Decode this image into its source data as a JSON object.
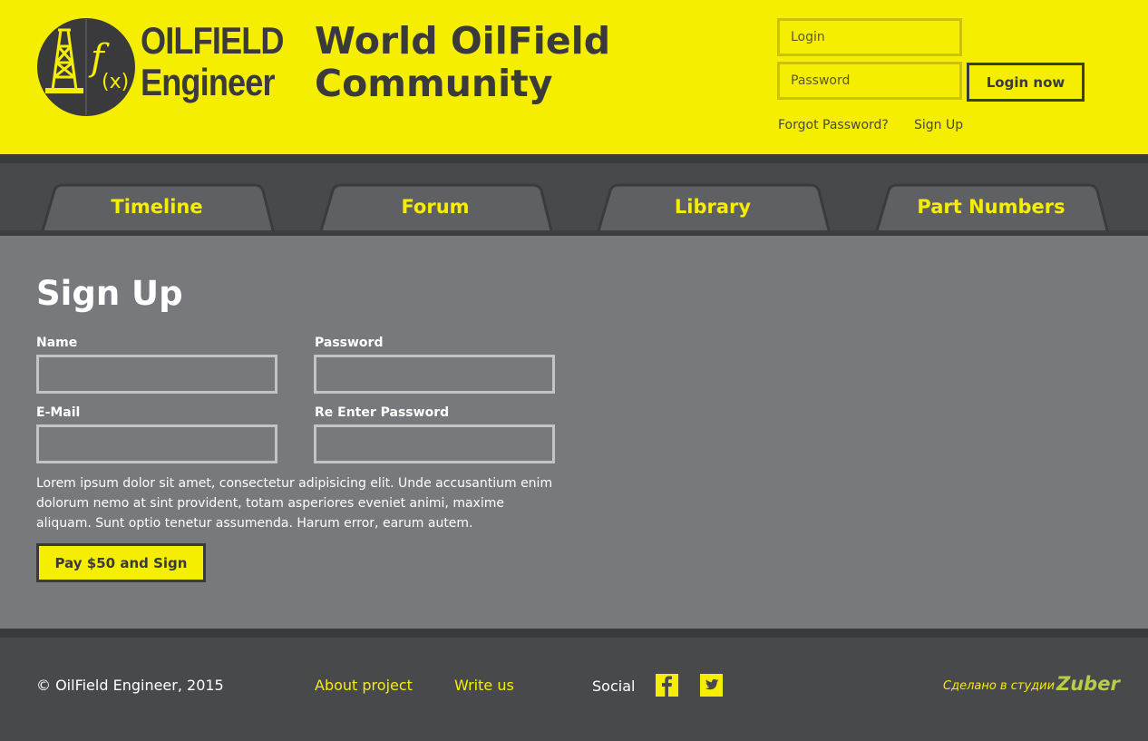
{
  "header": {
    "logo_line1": "OILFIELD",
    "logo_line2": "Engineer",
    "title_line1": "World OilField",
    "title_line2": "Community",
    "login_placeholder": "Login",
    "password_placeholder": "Password",
    "login_button": "Login now",
    "forgot_password": "Forgot Password?",
    "sign_up": "Sign Up"
  },
  "nav": {
    "tabs": [
      {
        "label": "Timeline"
      },
      {
        "label": "Forum"
      },
      {
        "label": "Library"
      },
      {
        "label": "Part Numbers"
      }
    ]
  },
  "main": {
    "title": "Sign Up",
    "fields": {
      "name_label": "Name",
      "password_label": "Password",
      "email_label": "E-Mail",
      "reenter_label": "Re Enter Password"
    },
    "description": "Lorem ipsum dolor sit amet, consectetur adipisicing elit. Unde accusantium enim dolorum nemo at sint provident, totam asperiores eveniet animi, maxime aliquam. Sunt optio tenetur assumenda. Harum error, earum autem.",
    "submit_button": "Pay $50 and Sign"
  },
  "footer": {
    "copyright": "© OilField Engineer, 2015",
    "about": "About project",
    "write_us": "Write us",
    "social_label": "Social",
    "social_icons": [
      "facebook-icon",
      "twitter-icon"
    ],
    "studio_text": "Сделано в студии",
    "studio_brand": "Zuber"
  },
  "colors": {
    "accent_yellow": "#f6ee00",
    "dark": "#48494b",
    "panel_gray": "#77797c"
  }
}
